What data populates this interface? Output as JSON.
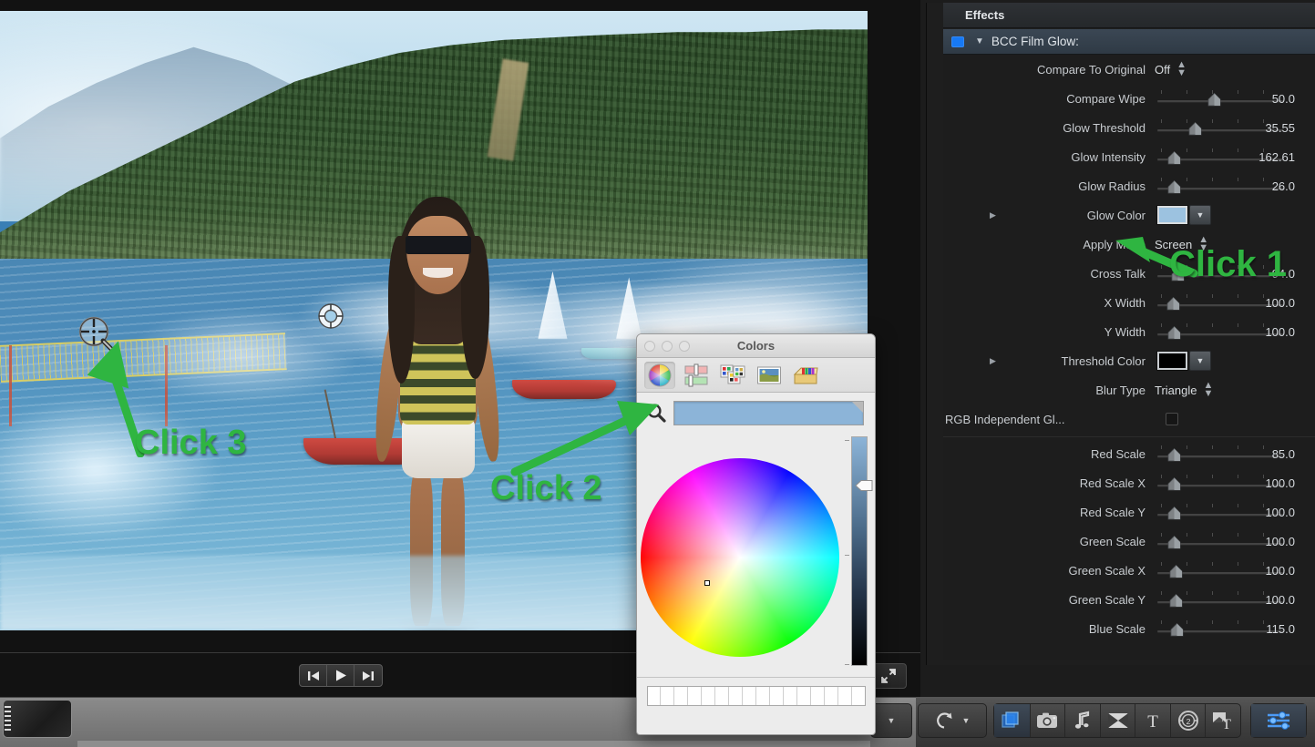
{
  "app": {
    "viewer": {
      "image_description": "beach-scene-with-film-glow-effect",
      "onscreen_control": "center-point-widget",
      "picker_cursor": "eyedropper-magnifier-cursor"
    },
    "playback": {
      "prev_label": "▌◀",
      "play_label": "▶",
      "next_label": "▶▌",
      "expand_icon": "expand-arrows-icon"
    }
  },
  "annotations": [
    {
      "id": "click1",
      "label": "Click 1",
      "color": "#2fb541",
      "target": "glow-color-swatch"
    },
    {
      "id": "click2",
      "label": "Click 2",
      "color": "#2fb541",
      "target": "colors-magnifier-icon"
    },
    {
      "id": "click3",
      "label": "Click 3",
      "color": "#2fb541",
      "target": "viewer-eyedropper-cursor"
    }
  ],
  "inspector": {
    "tab_label": "Effects",
    "effect": {
      "title": "BCC Film Glow:",
      "enabled": true,
      "enable_color": "#1779f5",
      "expanded": true,
      "disclosure": "▼"
    },
    "params": [
      {
        "label": "Compare To Original",
        "type": "popup",
        "value": "Off"
      },
      {
        "label": "Compare Wipe",
        "type": "slider",
        "value": "50.0",
        "pos": 44
      },
      {
        "label": "Glow Threshold",
        "type": "slider",
        "value": "35.55",
        "pos": 27
      },
      {
        "label": "Glow Intensity",
        "type": "slider",
        "value": "162.61",
        "pos": 9
      },
      {
        "label": "Glow Radius",
        "type": "slider",
        "value": "26.0",
        "pos": 9
      },
      {
        "label": "Glow Color",
        "type": "color",
        "value": "#9cc2e0",
        "disclosure": "▶"
      },
      {
        "label": "Apply Mode",
        "type": "popup",
        "value": "Screen"
      },
      {
        "label": "Cross Talk",
        "type": "slider",
        "value": "94.0",
        "pos": 12
      },
      {
        "label": "X Width",
        "type": "slider",
        "value": "100.0",
        "pos": 8
      },
      {
        "label": "Y Width",
        "type": "slider",
        "value": "100.0",
        "pos": 9
      },
      {
        "label": "Threshold Color",
        "type": "color",
        "value": "#000000",
        "disclosure": "▶"
      },
      {
        "label": "Blur Type",
        "type": "popup",
        "value": "Triangle"
      },
      {
        "label": "RGB Independent Gl...",
        "type": "checkbox",
        "value": "",
        "checked": false
      },
      {
        "label": "Red Scale",
        "type": "slider",
        "value": "85.0",
        "pos": 9
      },
      {
        "label": "Red Scale X",
        "type": "slider",
        "value": "100.0",
        "pos": 9
      },
      {
        "label": "Red Scale Y",
        "type": "slider",
        "value": "100.0",
        "pos": 9
      },
      {
        "label": "Green Scale",
        "type": "slider",
        "value": "100.0",
        "pos": 9
      },
      {
        "label": "Green Scale X",
        "type": "slider",
        "value": "100.0",
        "pos": 10
      },
      {
        "label": "Green Scale Y",
        "type": "slider",
        "value": "100.0",
        "pos": 10
      },
      {
        "label": "Blue Scale",
        "type": "slider",
        "value": "115.0",
        "pos": 11
      }
    ]
  },
  "colors_dialog": {
    "title": "Colors",
    "traffic_lights": [
      "close-button",
      "minimize-button",
      "zoom-button"
    ],
    "tools": [
      {
        "name": "color-wheel-tool",
        "active": true
      },
      {
        "name": "color-sliders-tool",
        "active": false
      },
      {
        "name": "color-palettes-tool",
        "active": false
      },
      {
        "name": "image-palettes-tool",
        "active": false
      },
      {
        "name": "crayons-tool",
        "active": false
      }
    ],
    "magnifier_icon": "magnifier-eyedropper-icon",
    "selected_color": "#8cb4d8",
    "brightness": 80,
    "swatch_count": 16,
    "swatch_color": "#ffffff"
  },
  "bottom_toolbar": {
    "groups": [
      {
        "name": "tool-dropdown",
        "buttons": [
          {
            "name": "tool-caret",
            "icon": "caret-down-icon",
            "active": false
          }
        ]
      },
      {
        "name": "retime-group",
        "buttons": [
          {
            "name": "retime-button",
            "icon": "retime-icon",
            "active": false
          }
        ]
      },
      {
        "name": "browsers-group",
        "buttons": [
          {
            "name": "effects-browser-button",
            "icon": "layers-icon",
            "active": true
          },
          {
            "name": "photos-browser-button",
            "icon": "camera-icon",
            "active": false
          },
          {
            "name": "music-browser-button",
            "icon": "music-note-icon",
            "active": false
          },
          {
            "name": "transitions-browser-button",
            "icon": "transition-x-icon",
            "active": false
          },
          {
            "name": "titles-browser-button",
            "icon": "text-t-icon",
            "active": false
          },
          {
            "name": "generators-browser-button",
            "icon": "generator-circle-icon",
            "active": false
          },
          {
            "name": "themes-browser-button",
            "icon": "themes-icon",
            "active": false
          }
        ]
      },
      {
        "name": "inspector-group",
        "buttons": [
          {
            "name": "inspector-button",
            "icon": "sliders-icon",
            "active": true
          }
        ]
      }
    ]
  }
}
